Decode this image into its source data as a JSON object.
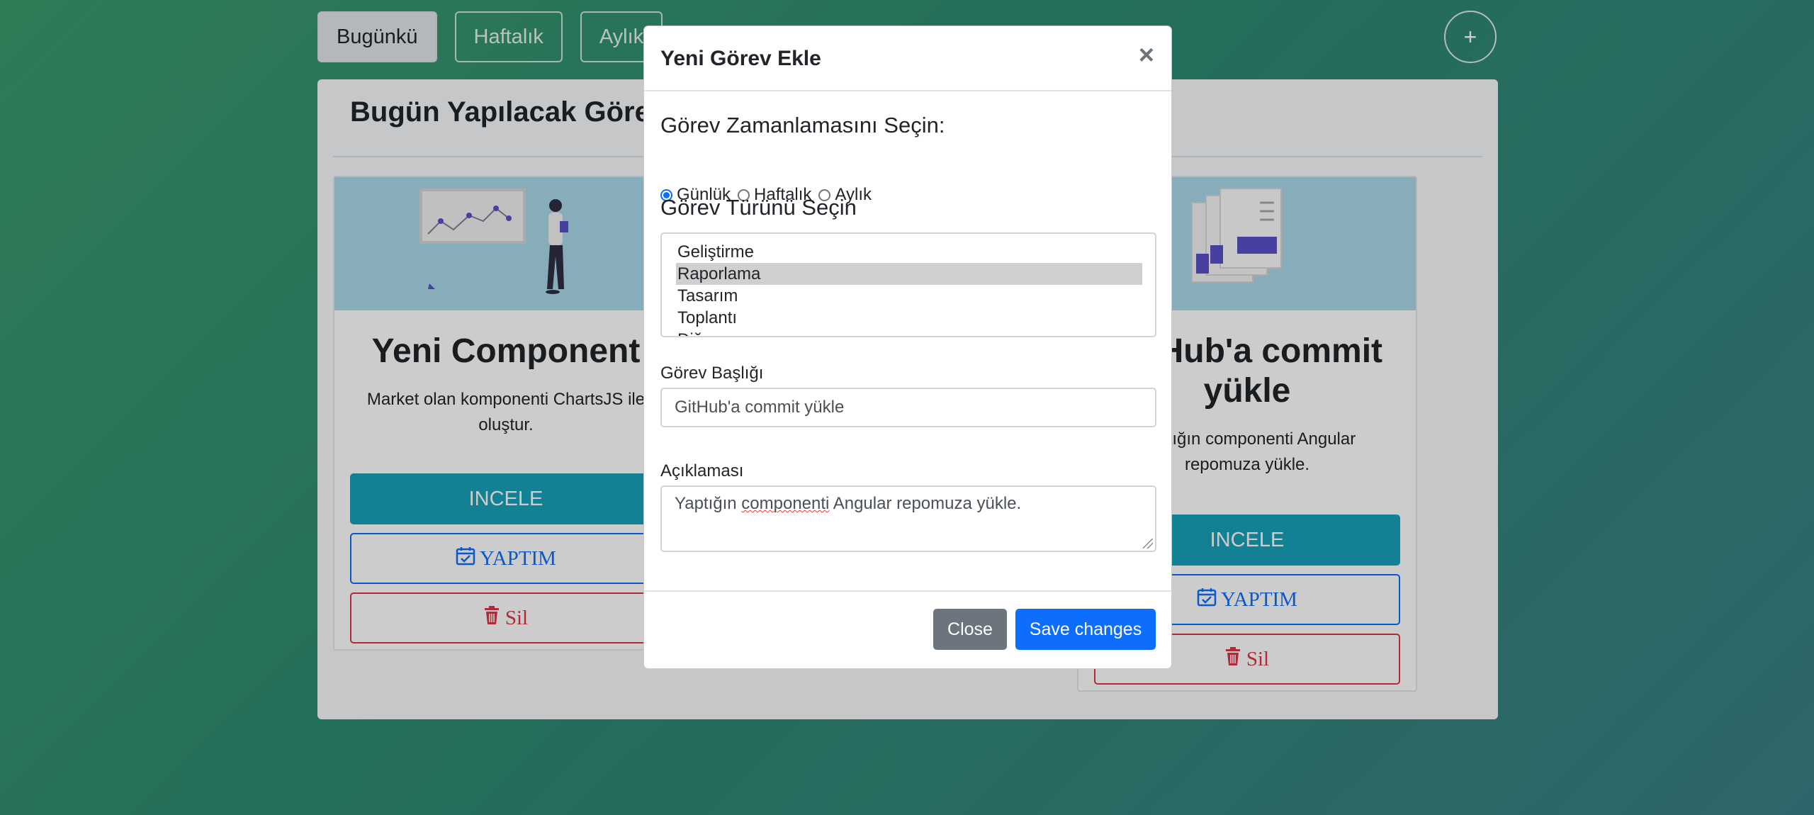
{
  "nav": {
    "tabs": [
      {
        "label": "Bugünkü",
        "active": true
      },
      {
        "label": "Haftalık",
        "active": false
      },
      {
        "label": "Aylık",
        "active": false
      }
    ],
    "add_button": "+"
  },
  "panel": {
    "title": "Bugün Yapılacak Görevler",
    "cards": [
      {
        "title": "Yeni Component",
        "text": "Market olan komponenti ChartsJS ile oluştur.",
        "inspect_label": "INCELE",
        "done_label": "YAPTIM",
        "delete_label": "Sil"
      },
      {
        "title": "GitHub'a commit yükle",
        "text": "Yaptığın componenti Angular repomuza yükle.",
        "inspect_label": "INCELE",
        "done_label": "YAPTIM",
        "delete_label": "Sil"
      }
    ]
  },
  "modal": {
    "title": "Yeni Görev Ekle",
    "close_symbol": "×",
    "schedule_label": "Görev Zamanlamasını Seçin:",
    "schedule_options": [
      {
        "label": "Günlük",
        "checked": true
      },
      {
        "label": "Haftalık",
        "checked": false
      },
      {
        "label": "Aylık",
        "checked": false
      }
    ],
    "type_label": "Görev Türünü Seçin",
    "type_options": [
      "Geliştirme",
      "Raporlama",
      "Tasarım",
      "Toplantı",
      "Diğer"
    ],
    "type_selected": "Raporlama",
    "title_field_label": "Görev Başlığı",
    "title_field_value": "GitHub'a commit yükle",
    "description_label": "Açıklaması",
    "description_value_before": "Yaptığın ",
    "description_value_misspelled": "componenti",
    "description_value_after": " Angular repomuza yükle.",
    "close_button": "Close",
    "save_button": "Save changes"
  },
  "colors": {
    "primary": "#0d6efd",
    "info": "#17a2b8",
    "danger": "#dc3545",
    "secondary": "#6c757d",
    "card_image_bg": "#a9d9ea"
  },
  "icons": {
    "done": "calendar-check-icon",
    "delete": "trash-icon",
    "close": "close-icon"
  }
}
